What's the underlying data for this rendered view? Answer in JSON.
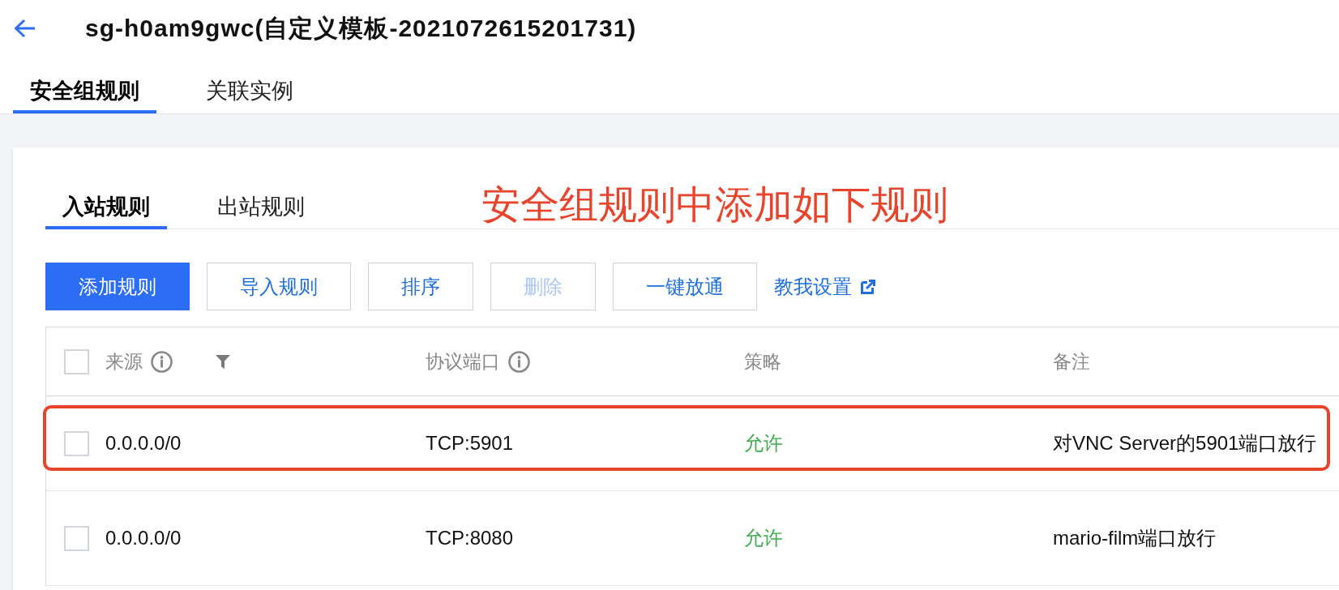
{
  "header": {
    "title": "sg-h0am9gwc(自定义模板-2021072615201731)"
  },
  "tabs": [
    {
      "label": "安全组规则",
      "selected": true
    },
    {
      "label": "关联实例",
      "selected": false
    }
  ],
  "rule_tabs": [
    {
      "label": "入站规则",
      "selected": true
    },
    {
      "label": "出站规则",
      "selected": false
    }
  ],
  "annotation": {
    "text": "安全组规则中添加如下规则"
  },
  "toolbar": {
    "buttons": [
      {
        "label": "添加规则",
        "kind": "primary",
        "disabled": false
      },
      {
        "label": "导入规则",
        "kind": "default",
        "disabled": false
      },
      {
        "label": "排序",
        "kind": "default",
        "disabled": false
      },
      {
        "label": "删除",
        "kind": "default",
        "disabled": true
      },
      {
        "label": "一键放通",
        "kind": "default",
        "disabled": false
      }
    ],
    "help_link": {
      "label": "教我设置"
    }
  },
  "table": {
    "select_all": {
      "checked": false
    },
    "columns": [
      {
        "label": "来源",
        "info_icon": true,
        "filter_icon": true
      },
      {
        "label": "协议端口",
        "info_icon": true,
        "filter_icon": false
      },
      {
        "label": "策略",
        "info_icon": false,
        "filter_icon": false
      },
      {
        "label": "备注",
        "info_icon": false,
        "filter_icon": false
      }
    ],
    "rows": [
      {
        "checked": false,
        "highlighted": true,
        "source": "0.0.0.0/0",
        "protocol_port": "TCP:5901",
        "policy": "允许",
        "note": "对VNC Server的5901端口放行"
      },
      {
        "checked": false,
        "highlighted": false,
        "source": "0.0.0.0/0",
        "protocol_port": "TCP:8080",
        "policy": "允许",
        "note": "mario-film端口放行"
      }
    ]
  }
}
